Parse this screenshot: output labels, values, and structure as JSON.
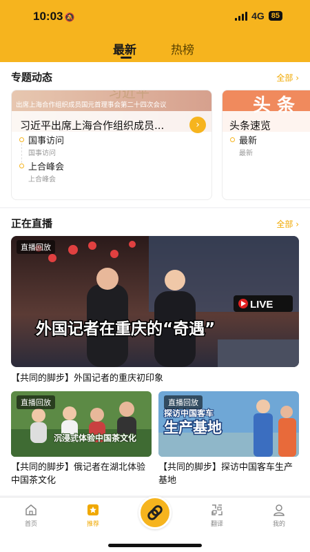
{
  "status": {
    "time": "10:03",
    "network": "4G",
    "battery": "85"
  },
  "top_tabs": [
    {
      "label": "最新"
    },
    {
      "label": "热榜"
    }
  ],
  "topics_section": {
    "title": "专题动态",
    "more": "全部 ›",
    "cards": [
      {
        "banner_text": "出席上海合作组织成员国元首理事会第二十四次会议",
        "headline": "习近平出席上海合作组织成员...",
        "items": [
          {
            "label": "国事访问",
            "sub": "国事访问"
          },
          {
            "label": "上合峰会",
            "sub": "上合峰会"
          }
        ]
      },
      {
        "banner_text": "头 条",
        "headline": "头条速览",
        "items": [
          {
            "label": "最新",
            "sub": "最新"
          }
        ]
      }
    ]
  },
  "live_section": {
    "title": "正在直播",
    "more": "全部 ›",
    "main": {
      "badge": "直播回放",
      "live_tag": "LIVE",
      "overlay": "外国记者在重庆的“奇遇”",
      "caption": "【共同的脚步】外国记者的重庆初印象"
    },
    "grid": [
      {
        "badge": "直播回放",
        "overlay": "沉浸式体验中国茶文化",
        "caption": "【共同的脚步】俄记者在湖北体验中国茶文化"
      },
      {
        "badge": "直播回放",
        "overlay_line1": "探访中国客车",
        "overlay_line2": "生产基地",
        "caption": "【共同的脚步】探访中国客车生产基地"
      }
    ]
  },
  "tabbar": [
    {
      "label": "首页",
      "icon": "home-icon"
    },
    {
      "label": "推荐",
      "icon": "star-icon"
    },
    {
      "label": "",
      "icon": "link-icon"
    },
    {
      "label": "翻译",
      "icon": "translate-icon"
    },
    {
      "label": "我的",
      "icon": "user-icon"
    }
  ],
  "colors": {
    "accent": "#f6b41e",
    "more_link": "#f0a800"
  }
}
